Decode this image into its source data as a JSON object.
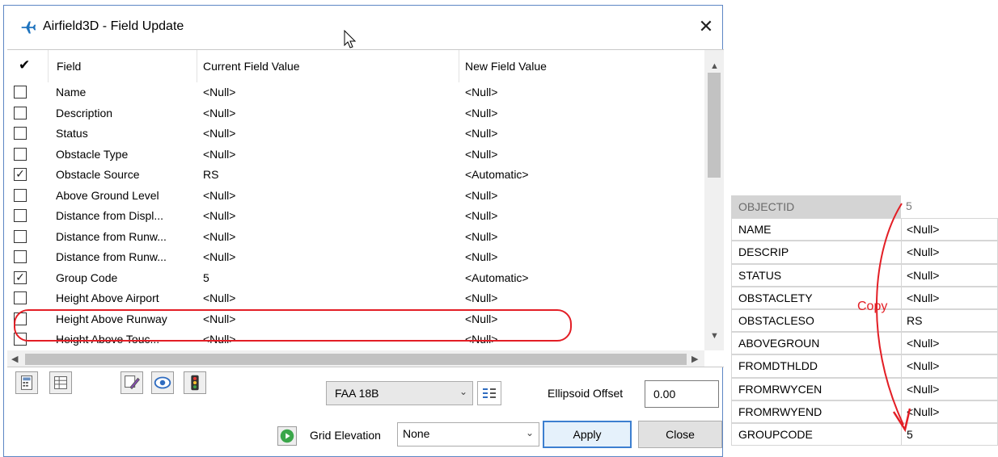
{
  "dialog": {
    "title": "Airfield3D - Field Update",
    "close_glyph": "✕"
  },
  "grid": {
    "header": {
      "check": "✔",
      "field": "Field",
      "current": "Current Field Value",
      "new": "New Field Value"
    },
    "rows": [
      {
        "checked": false,
        "field": "Name",
        "current": "<Null>",
        "new": "<Null>"
      },
      {
        "checked": false,
        "field": "Description",
        "current": "<Null>",
        "new": "<Null>"
      },
      {
        "checked": false,
        "field": "Status",
        "current": "<Null>",
        "new": "<Null>"
      },
      {
        "checked": false,
        "field": "Obstacle Type",
        "current": "<Null>",
        "new": "<Null>"
      },
      {
        "checked": true,
        "field": "Obstacle Source",
        "current": "RS",
        "new": "<Automatic>"
      },
      {
        "checked": false,
        "field": "Above Ground Level",
        "current": "<Null>",
        "new": "<Null>"
      },
      {
        "checked": false,
        "field": "Distance from Displ...",
        "current": "<Null>",
        "new": "<Null>"
      },
      {
        "checked": false,
        "field": "Distance from Runw...",
        "current": "<Null>",
        "new": "<Null>"
      },
      {
        "checked": false,
        "field": "Distance from Runw...",
        "current": "<Null>",
        "new": "<Null>"
      },
      {
        "checked": true,
        "field": "Group Code",
        "current": "5",
        "new": "<Automatic>"
      },
      {
        "checked": false,
        "field": "Height Above Airport",
        "current": "<Null>",
        "new": "<Null>"
      },
      {
        "checked": false,
        "field": "Height Above Runway",
        "current": "<Null>",
        "new": "<Null>"
      },
      {
        "checked": false,
        "field": "Height Above Touc...",
        "current": "<Null>",
        "new": "<Null>"
      }
    ]
  },
  "toolbar": {
    "standard": "FAA 18B",
    "ellipsoid_label": "Ellipsoid Offset",
    "ellipsoid_value": "0.00",
    "grid_elevation_label": "Grid Elevation",
    "grid_elevation_value": "None",
    "apply": "Apply",
    "close": "Close"
  },
  "attributes": {
    "header": {
      "name": "OBJECTID",
      "value": "5"
    },
    "rows": [
      {
        "name": "NAME",
        "value": "<Null>"
      },
      {
        "name": "DESCRIP",
        "value": "<Null>"
      },
      {
        "name": "STATUS",
        "value": "<Null>"
      },
      {
        "name": "OBSTACLETY",
        "value": "<Null>"
      },
      {
        "name": "OBSTACLESO",
        "value": "RS"
      },
      {
        "name": "ABOVEGROUN",
        "value": "<Null>"
      },
      {
        "name": "FROMDTHLDD",
        "value": "<Null>"
      },
      {
        "name": "FROMRWYCEN",
        "value": "<Null>"
      },
      {
        "name": "FROMRWYEND",
        "value": "<Null>"
      },
      {
        "name": "GROUPCODE",
        "value": "5"
      }
    ],
    "copy_label": "Copy"
  },
  "colors": {
    "accent_red": "#e31e25",
    "airplane_blue": "#1e73be",
    "dialog_border": "#5d86c4"
  },
  "icons": [
    "airplane-icon",
    "close-icon",
    "calculator-icon",
    "table-icon",
    "edit-pencil-icon",
    "eye-icon",
    "traffic-light-icon",
    "list-settings-icon",
    "play-icon",
    "chevron-down-icon"
  ]
}
